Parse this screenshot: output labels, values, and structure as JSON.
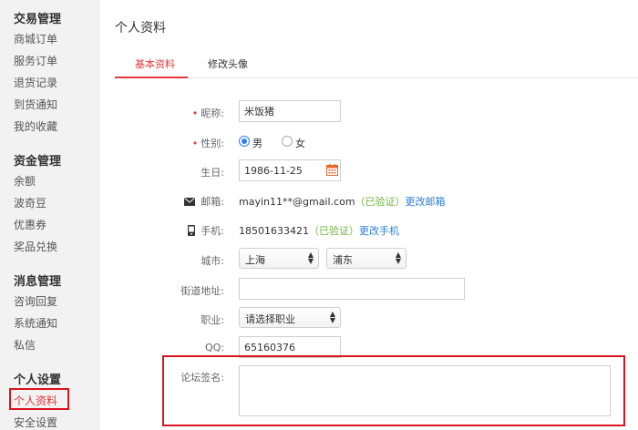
{
  "sidebar": {
    "groups": [
      {
        "title": "交易管理",
        "items": [
          "商城订单",
          "服务订单",
          "退货记录",
          "到货通知",
          "我的收藏"
        ]
      },
      {
        "title": "资金管理",
        "items": [
          "余额",
          "波奇豆",
          "优惠券",
          "奖品兑换"
        ]
      },
      {
        "title": "消息管理",
        "items": [
          "咨询回复",
          "系统通知",
          "私信"
        ]
      },
      {
        "title": "个人设置",
        "items": [
          "个人资料",
          "安全设置"
        ]
      }
    ]
  },
  "main": {
    "title": "个人资料",
    "tabs": [
      {
        "label": "基本资料"
      },
      {
        "label": "修改头像"
      }
    ],
    "form": {
      "nickname": {
        "label": "昵称:",
        "value": "米饭猪"
      },
      "gender": {
        "label": "性别:",
        "options": [
          "男",
          "女"
        ],
        "selected": "男"
      },
      "birthday": {
        "label": "生日:",
        "value": "1986-11-25"
      },
      "email": {
        "label": "邮箱:",
        "value": "mayin11**@gmail.com",
        "status": "（已验证）",
        "action": "更改邮箱"
      },
      "phone": {
        "label": "手机:",
        "value": "18501633421",
        "status": "（已验证）",
        "action": "更改手机"
      },
      "city": {
        "label": "城市:",
        "province": "上海",
        "district": "浦东"
      },
      "street": {
        "label": "街道地址:",
        "value": ""
      },
      "job": {
        "label": "职业:",
        "value": "请选择职业"
      },
      "qq": {
        "label": "QQ:",
        "value": "65160376"
      },
      "signature": {
        "label": "论坛签名:",
        "value": ""
      }
    }
  },
  "colors": {
    "accent": "#e4393c",
    "verified": "#6fb43f",
    "link": "#2a7fd6",
    "highlight": "#d9141c"
  },
  "icons": {
    "email": "envelope-icon",
    "phone": "phone-icon",
    "calendar": "calendar-icon"
  }
}
